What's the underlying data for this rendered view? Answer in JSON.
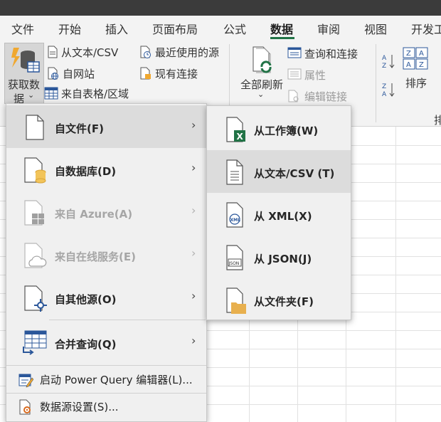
{
  "ribbon_tabs": [
    "文件",
    "开始",
    "插入",
    "页面布局",
    "公式",
    "数据",
    "审阅",
    "视图",
    "开发工"
  ],
  "active_tab": "数据",
  "ribbon": {
    "get_data_line1": "获取数",
    "get_data_line2": "据",
    "from_text_csv": "从文本/CSV",
    "from_web": "自网站",
    "from_table_range": "来自表格/区域",
    "recent_sources": "最近使用的源",
    "existing_connections": "现有连接",
    "refresh_all": "全部刷新",
    "queries_connections": "查询和连接",
    "properties": "属性",
    "edit_links": "编辑链接",
    "sort_label": "排序",
    "sort_filter_group_partial": "排"
  },
  "menu": {
    "items": [
      {
        "label": "自文件(F)",
        "icon": "file-icon",
        "disabled": false
      },
      {
        "label": "自数据库(D)",
        "icon": "database-icon",
        "disabled": false
      },
      {
        "label": "来自 Azure(A)",
        "icon": "azure-icon",
        "disabled": true
      },
      {
        "label": "来自在线服务(E)",
        "icon": "cloud-icon",
        "disabled": true
      },
      {
        "label": "自其他源(O)",
        "icon": "other-sources-icon",
        "disabled": false
      },
      {
        "label": "合并查询(Q)",
        "icon": "combine-icon",
        "disabled": false
      }
    ],
    "bottom": [
      {
        "label": "启动 Power Query 编辑器(L)...",
        "icon": "power-query-icon"
      },
      {
        "label": "数据源设置(S)...",
        "icon": "data-source-settings-icon"
      }
    ]
  },
  "submenu": {
    "items": [
      {
        "label": "从工作簿(W)",
        "icon": "excel-workbook-icon"
      },
      {
        "label": "从文本/CSV (T)",
        "icon": "text-csv-icon"
      },
      {
        "label": "从 XML(X)",
        "icon": "xml-icon"
      },
      {
        "label": "从 JSON(J)",
        "icon": "json-icon"
      },
      {
        "label": "从文件夹(F)",
        "icon": "folder-icon"
      }
    ]
  },
  "icon_texts": {
    "xml": "XML",
    "json": "JSON",
    "excel_x": "X"
  },
  "colors": {
    "accent": "#217346",
    "folder": "#e8b04e",
    "database": "#f2c45a",
    "blue": "#2b579a"
  }
}
